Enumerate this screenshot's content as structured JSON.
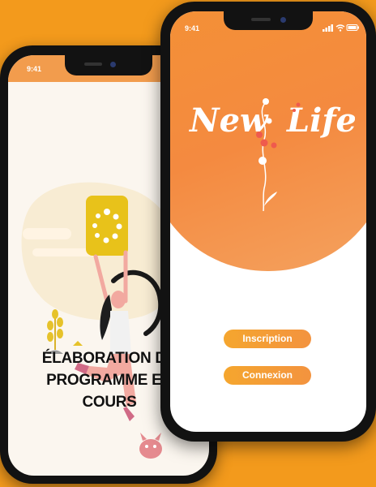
{
  "back_phone": {
    "status_time": "9:41",
    "message_lines": [
      "ÉLABORATION DU",
      "PROGRAMME EN",
      "COURS"
    ]
  },
  "front_phone": {
    "status_time": "9:41",
    "logo_text": "New Life",
    "buttons": {
      "inscription_label": "Inscription",
      "connexion_label": "Connexion"
    }
  },
  "colors": {
    "background": "#f39a1c",
    "hero_orange": "#f48a40",
    "button_orange": "#f5a62e",
    "phone_frame": "#121212"
  }
}
